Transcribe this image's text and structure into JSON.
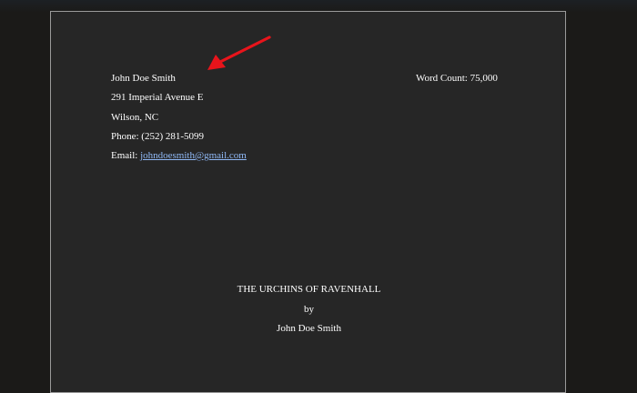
{
  "manuscript": {
    "contact": {
      "name": "John Doe Smith",
      "address": "291 Imperial Avenue E",
      "city": "Wilson, NC",
      "phone": "Phone: (252) 281-5099",
      "email_label": "Email: ",
      "email": "johndoesmith@gmail.com"
    },
    "word_count": "Word Count: 75,000",
    "title": "THE URCHINS OF RAVENHALL",
    "by": "by",
    "author": "John Doe Smith"
  },
  "annotation": {
    "arrow_color": "#e8141b"
  },
  "colors": {
    "page_background": "#262626",
    "link": "#8fb8f5"
  }
}
